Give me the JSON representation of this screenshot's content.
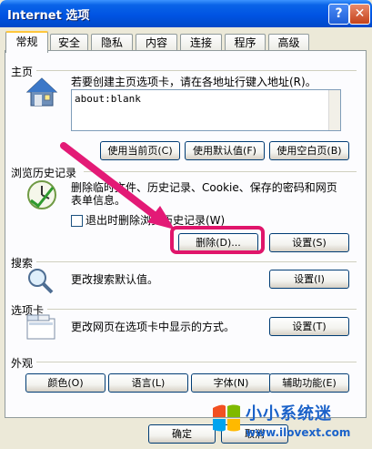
{
  "window": {
    "title": "Internet 选项",
    "help_button": "?",
    "close_button": "✕"
  },
  "tabs": [
    {
      "label": "常规",
      "active": true
    },
    {
      "label": "安全"
    },
    {
      "label": "隐私"
    },
    {
      "label": "内容"
    },
    {
      "label": "连接"
    },
    {
      "label": "程序"
    },
    {
      "label": "高级"
    }
  ],
  "homepage": {
    "title": "主页",
    "description": "若要创建主页选项卡，请在各地址行键入地址(R)。",
    "address_value": "about:blank",
    "buttons": [
      "使用当前页(C)",
      "使用默认值(F)",
      "使用空白页(B)"
    ]
  },
  "history": {
    "title": "浏览历史记录",
    "description_line1": "删除临时文件、历史记录、Cookie、保存的密码和网页",
    "description_line2": "表单信息。",
    "checkbox_label": "退出时删除浏览历史记录(W)",
    "delete_button": "删除(D)...",
    "settings_button": "设置(S)"
  },
  "search": {
    "title": "搜索",
    "description": "更改搜索默认值。",
    "settings_button": "设置(I)"
  },
  "tabs_section": {
    "title": "选项卡",
    "description": "更改网页在选项卡中显示的方式。",
    "settings_button": "设置(T)"
  },
  "appearance": {
    "title": "外观",
    "buttons": [
      "颜色(O)",
      "语言(L)",
      "字体(N)",
      "辅助功能(E)"
    ]
  },
  "footer": {
    "ok": "确定",
    "cancel": "取消"
  },
  "watermark": {
    "brand": "小小系统迷",
    "url": "www.ilovext.com"
  },
  "colors": {
    "highlight": "#e0156b",
    "arrow": "#e31a76",
    "titlebar": "#0054e3"
  }
}
